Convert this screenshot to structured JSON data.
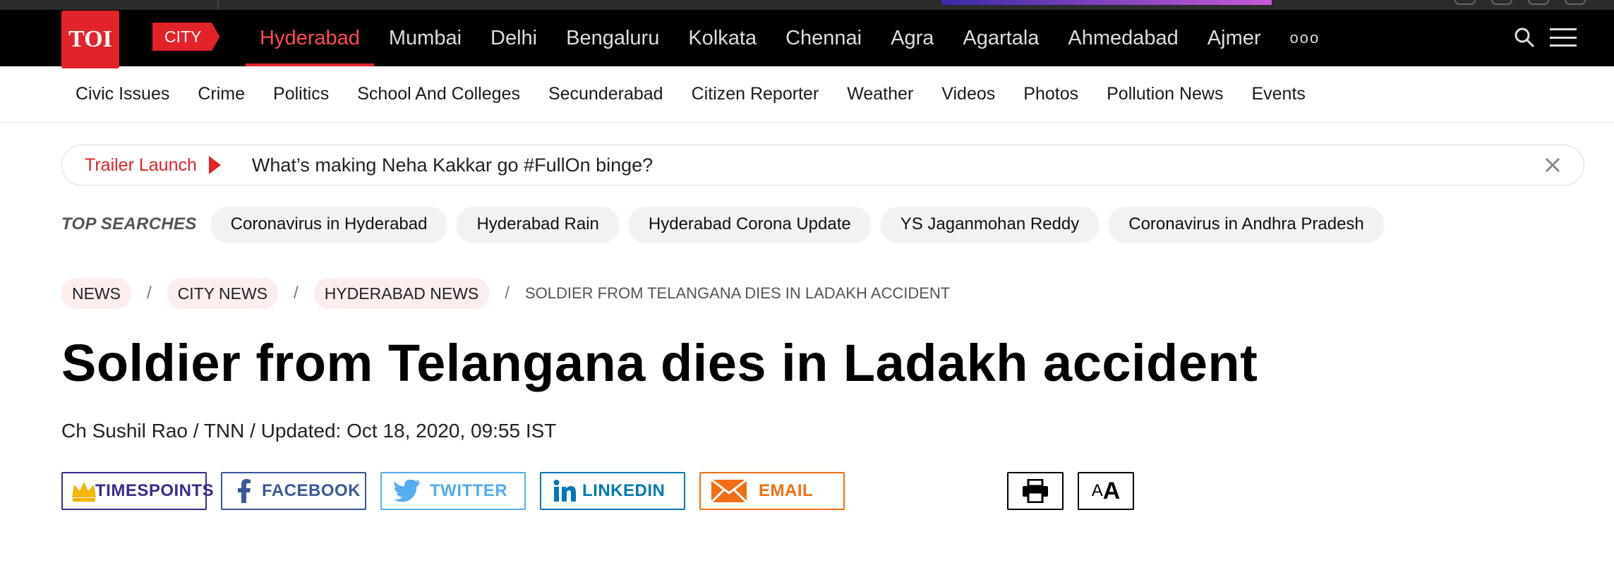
{
  "header": {
    "logo_text": "TOI",
    "city_tag": "CITY",
    "nav_links": [
      "Hyderabad",
      "Mumbai",
      "Delhi",
      "Bengaluru",
      "Kolkata",
      "Chennai",
      "Agra",
      "Agartala",
      "Ahmedabad",
      "Ajmer"
    ],
    "active_link": "Hyderabad",
    "more_label": "ooo",
    "colors": {
      "brand_red": "#e2232a",
      "nav_bg": "#000000",
      "active_text": "#ff4d52"
    }
  },
  "subnav": {
    "items": [
      "Civic Issues",
      "Crime",
      "Politics",
      "School And Colleges",
      "Secunderabad",
      "Citizen Reporter",
      "Weather",
      "Videos",
      "Photos",
      "Pollution News",
      "Events"
    ]
  },
  "ticker": {
    "label": "Trailer Launch",
    "text": "What’s making Neha Kakkar go #FullOn binge?"
  },
  "top_searches": {
    "title": "TOP SEARCHES",
    "chips": [
      "Coronavirus in Hyderabad",
      "Hyderabad Rain",
      "Hyderabad Corona Update",
      "YS Jaganmohan Reddy",
      "Coronavirus in Andhra Pradesh"
    ]
  },
  "breadcrumb": {
    "items": [
      "NEWS",
      "CITY NEWS",
      "HYDERABAD NEWS"
    ],
    "separator": "/",
    "current": "SOLDIER FROM TELANGANA DIES IN LADAKH ACCIDENT"
  },
  "article": {
    "headline": "Soldier from Telangana dies in Ladakh accident",
    "byline": "Ch Sushil Rao / TNN / Updated: Oct 18, 2020, 09:55 IST"
  },
  "share": {
    "timespoints": "TIMESPOINTS",
    "facebook": "FACEBOOK",
    "twitter": "TWITTER",
    "linkedin": "LINKEDIN",
    "email": "EMAIL"
  },
  "tools": {
    "font_small": "A",
    "font_large": "A"
  }
}
